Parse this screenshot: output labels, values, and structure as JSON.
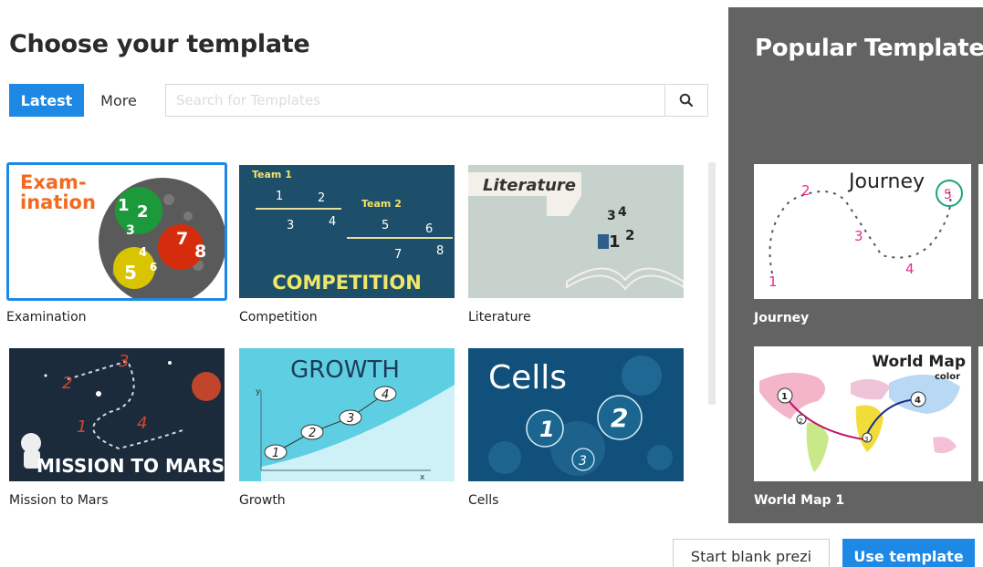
{
  "header": {
    "title": "Choose your template"
  },
  "tabs": [
    {
      "label": "Latest",
      "active": true
    },
    {
      "label": "More",
      "active": false
    }
  ],
  "search": {
    "placeholder": "Search for Templates",
    "value": "",
    "icon": "search-icon"
  },
  "templates": [
    {
      "name": "Examination",
      "selected": true,
      "thumb_text": "Exam-\nination",
      "thumb_numbers": [
        "1",
        "2",
        "3",
        "4",
        "5",
        "6",
        "7",
        "8"
      ]
    },
    {
      "name": "Competition",
      "selected": false,
      "thumb_text": "COMPETITION",
      "thumb_sub": [
        "Team 1",
        "Team 2"
      ],
      "thumb_numbers": [
        "1",
        "2",
        "3",
        "4",
        "5",
        "6",
        "7",
        "8"
      ]
    },
    {
      "name": "Literature",
      "selected": false,
      "thumb_text": "Literature",
      "thumb_numbers": [
        "1",
        "2",
        "3",
        "4"
      ]
    },
    {
      "name": "Mission to Mars",
      "selected": false,
      "thumb_text": "MISSION TO MARS",
      "thumb_numbers": [
        "1",
        "2",
        "3",
        "4"
      ]
    },
    {
      "name": "Growth",
      "selected": false,
      "thumb_text": "GROWTH",
      "thumb_numbers": [
        "1",
        "2",
        "3",
        "4"
      ],
      "thumb_axes": [
        "y",
        "x"
      ]
    },
    {
      "name": "Cells",
      "selected": false,
      "thumb_text": "Cells",
      "thumb_numbers": [
        "1",
        "2",
        "3"
      ]
    }
  ],
  "popular": {
    "title": "Popular Templates",
    "items": [
      {
        "name": "Journey",
        "thumb_text": "Journey",
        "thumb_numbers": [
          "1",
          "2",
          "3",
          "4",
          "5"
        ]
      },
      {
        "name": "World Map 1",
        "thumb_text": "World Map",
        "thumb_sub": "color",
        "thumb_numbers": [
          "1",
          "2",
          "3",
          "4"
        ]
      }
    ]
  },
  "footer": {
    "blank_label": "Start blank prezi",
    "use_label": "Use template"
  },
  "colors": {
    "accent": "#1e88e5",
    "sidebar": "#636363",
    "exam_orange": "#f26a21"
  }
}
